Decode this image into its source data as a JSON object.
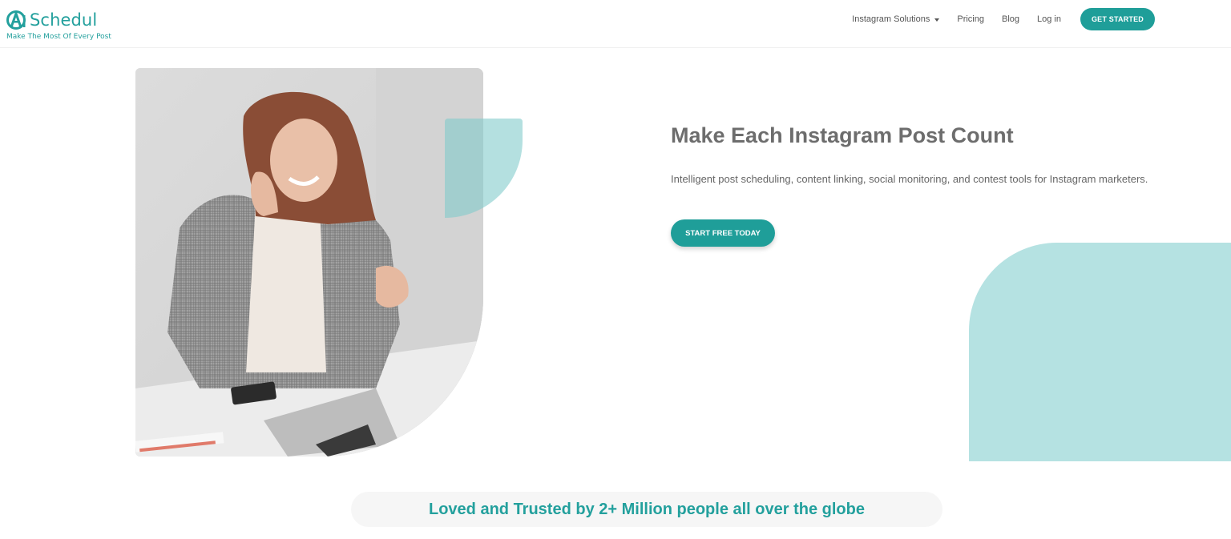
{
  "brand": {
    "name": "Schedul",
    "tagline": "Make The Most Of Every Post",
    "accent": "#1f9e99",
    "light_teal": "#b5e2e2"
  },
  "nav": {
    "items": [
      {
        "label": "Instagram Solutions",
        "has_dropdown": true
      },
      {
        "label": "Pricing"
      },
      {
        "label": "Blog"
      },
      {
        "label": "Log in"
      }
    ],
    "cta_label": "GET STARTED"
  },
  "hero": {
    "title": "Make Each Instagram Post Count",
    "subtitle": "Intelligent post scheduling, content linking, social monitoring, and contest tools for Instagram marketers.",
    "cta_label": "START FREE TODAY"
  },
  "trust": {
    "text": "Loved and Trusted by 2+ Million people all over the globe"
  }
}
